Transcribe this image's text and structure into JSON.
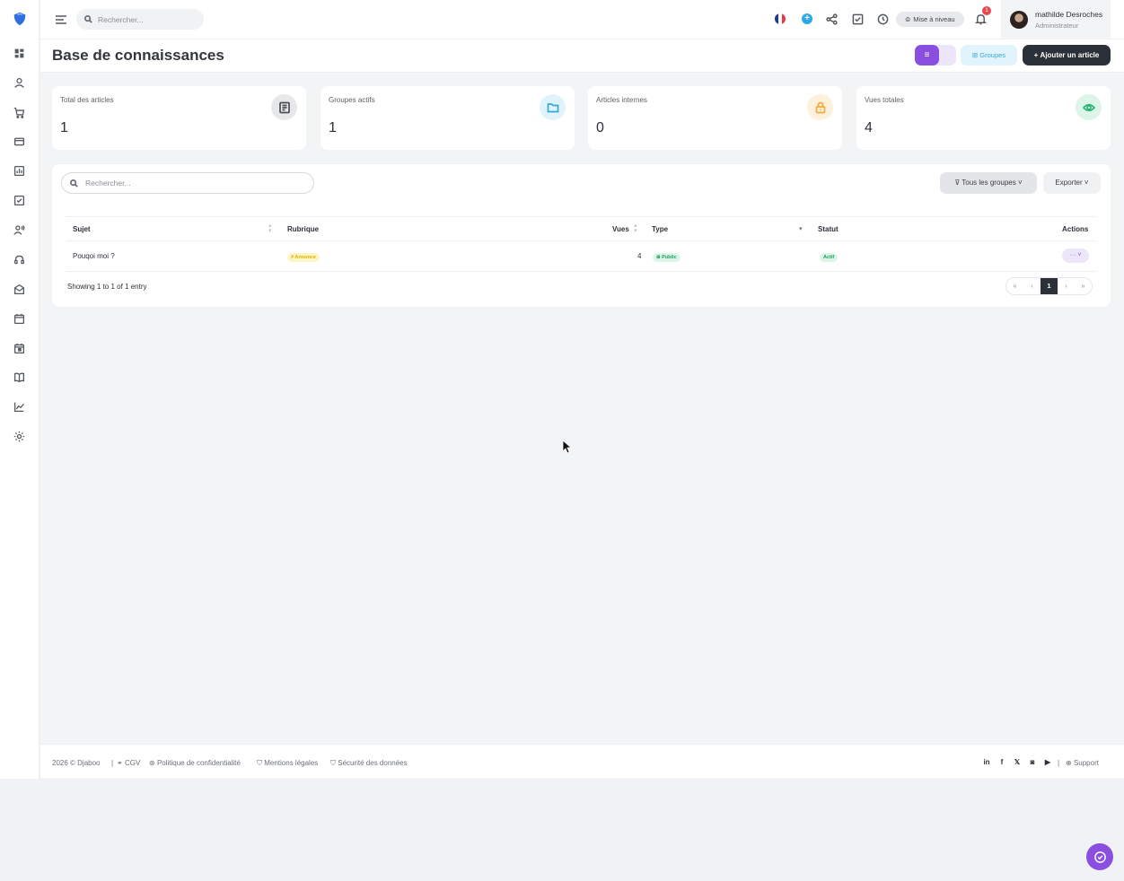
{
  "topbar": {
    "search_placeholder": "Rechercher...",
    "upgrade_label": "Mise à niveau",
    "notification_count": "1",
    "user_name": "mathilde Desroches",
    "user_role": "Administrateur"
  },
  "page": {
    "title": "Base de connaissances",
    "groups_label": "Groupes",
    "add_label": "Ajouter un article"
  },
  "stats": [
    {
      "label": "Total des articles",
      "value": "1",
      "icon": "article-icon",
      "color": "#6b7078"
    },
    {
      "label": "Groupes actifs",
      "value": "1",
      "icon": "folder-icon",
      "color": "#38a9d6"
    },
    {
      "label": "Articles internes",
      "value": "0",
      "icon": "lock-icon",
      "color": "#f2a93b"
    },
    {
      "label": "Vues totales",
      "value": "4",
      "icon": "eye-icon",
      "color": "#2bb673"
    }
  ],
  "table": {
    "search_placeholder": "Rechercher...",
    "filter_label": "Tous les groupes",
    "export_label": "Exporter",
    "columns": {
      "subject": "Sujet",
      "rubric": "Rubrique",
      "views": "Vues",
      "type": "Type",
      "status": "Statut",
      "actions": "Actions"
    },
    "rows": [
      {
        "subject": "Pouqoi moi ?",
        "rubric": "Annonce",
        "views": "4",
        "type": "Public",
        "status": "Actif"
      }
    ],
    "showing": "Showing 1 to 1 of 1 entry",
    "pager": {
      "first": "«",
      "prev": "‹",
      "current": "1",
      "next": "›",
      "last": "»"
    }
  },
  "footer": {
    "copyright": "2026 © Djaboo",
    "links": [
      "CGV",
      "Politique de confidentialité",
      "Mentions légales",
      "Sécurité des données"
    ],
    "support": "Support"
  },
  "colors": {
    "accent": "#8a4fe0",
    "dark": "#2c3038",
    "info": "#38a9d6"
  }
}
